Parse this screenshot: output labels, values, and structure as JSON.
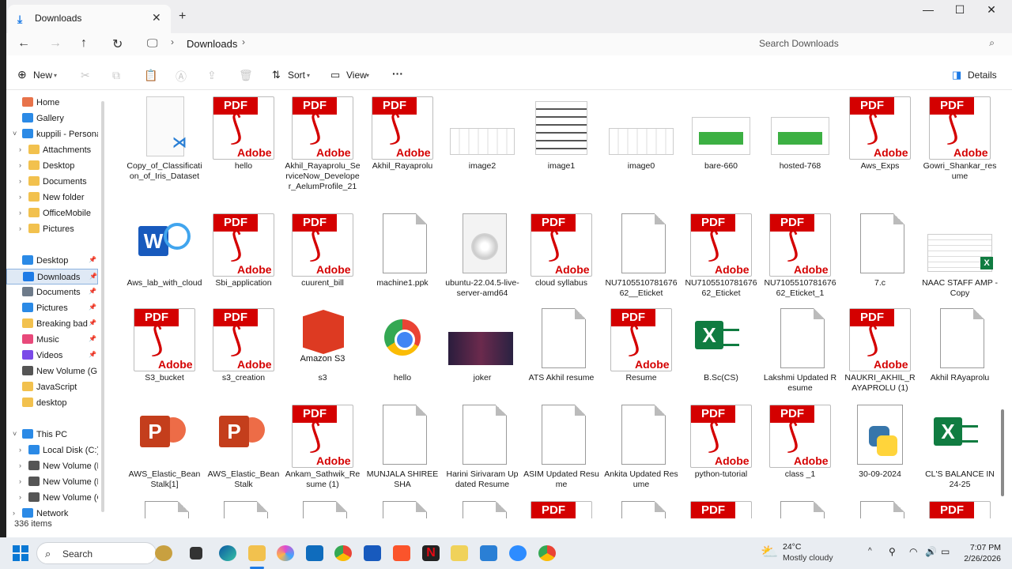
{
  "window": {
    "tab_title": "Downloads",
    "new_tab": "+",
    "controls": {
      "minimize": "—",
      "maximize": "☐",
      "close": "✕"
    }
  },
  "nav": {
    "breadcrumb": "Downloads",
    "search_placeholder": "Search Downloads"
  },
  "toolbar": {
    "new_label": "New",
    "sort_label": "Sort",
    "view_label": "View",
    "more_label": "···",
    "details_label": "Details"
  },
  "sidebar": {
    "items": [
      {
        "label": "Home",
        "color": "#e8734a"
      },
      {
        "label": "Gallery",
        "color": "#2b8ae6"
      },
      {
        "label": "kuppili - Personal",
        "color": "#2b8ae6"
      },
      {
        "label": "Attachments",
        "color": "#f2c14e"
      },
      {
        "label": "Desktop",
        "color": "#f2c14e"
      },
      {
        "label": "Documents",
        "color": "#f2c14e"
      },
      {
        "label": "New folder",
        "color": "#f2c14e"
      },
      {
        "label": "OfficeMobile",
        "color": "#f2c14e"
      },
      {
        "label": "Pictures",
        "color": "#f2c14e"
      },
      {
        "label": "Desktop",
        "color": "#2b8ae6"
      },
      {
        "label": "Downloads",
        "color": "#1e7be6"
      },
      {
        "label": "Documents",
        "color": "#6e7b8a"
      },
      {
        "label": "Pictures",
        "color": "#2b8ae6"
      },
      {
        "label": "Breaking bad",
        "color": "#f2c14e"
      },
      {
        "label": "Music",
        "color": "#e8497a"
      },
      {
        "label": "Videos",
        "color": "#7b4ae8"
      },
      {
        "label": "New Volume (G:)",
        "color": "#555555"
      },
      {
        "label": "JavaScript",
        "color": "#f2c14e"
      },
      {
        "label": "desktop",
        "color": "#f2c14e"
      },
      {
        "label": "This PC",
        "color": "#2b8ae6"
      },
      {
        "label": "Local Disk (C:)",
        "color": "#2b8ae6"
      },
      {
        "label": "New Volume (E:)",
        "color": "#555555"
      },
      {
        "label": "New Volume (F:)",
        "color": "#555555"
      },
      {
        "label": "New Volume (G:)",
        "color": "#555555"
      },
      {
        "label": "Network",
        "color": "#2b8ae6"
      }
    ],
    "status": "336 items"
  },
  "files": {
    "row1": [
      {
        "name": "Copy_of_Classification_of_Iris_Dataset",
        "icon": "vscode-file-icon"
      },
      {
        "name": "hello",
        "icon": "pdf-icon"
      },
      {
        "name": "Akhil_Rayaprolu_ServiceNow_Developer_AelumProfile_21",
        "icon": "pdf-icon"
      },
      {
        "name": "Akhil_Rayaprolu",
        "icon": "pdf-icon"
      },
      {
        "name": "image2",
        "icon": "image-thumbnail"
      },
      {
        "name": "image1",
        "icon": "image-thumbnail"
      },
      {
        "name": "image0",
        "icon": "image-thumbnail"
      },
      {
        "name": "bare-660",
        "icon": "image-thumbnail"
      },
      {
        "name": "hosted-768",
        "icon": "image-thumbnail"
      },
      {
        "name": "Aws_Exps",
        "icon": "pdf-icon"
      },
      {
        "name": "Gowri_Shankar_resume",
        "icon": "pdf-icon"
      }
    ],
    "row2": [
      {
        "name": "Aws_lab_with_cloud",
        "icon": "word-icon"
      },
      {
        "name": "Sbi_application",
        "icon": "pdf-icon"
      },
      {
        "name": "cuurent_bill",
        "icon": "pdf-icon"
      },
      {
        "name": "machine1.ppk",
        "icon": "blank-file-icon"
      },
      {
        "name": "ubuntu-22.04.5-live-server-amd64",
        "icon": "disc-image-icon"
      },
      {
        "name": "cloud syllabus",
        "icon": "pdf-icon"
      },
      {
        "name": "NU710551078167662__Eticket",
        "icon": "blank-file-icon"
      },
      {
        "name": "NU710551078167662_Eticket",
        "icon": "pdf-icon"
      },
      {
        "name": "NU710551078167662_Eticket_1",
        "icon": "pdf-icon"
      },
      {
        "name": "7.c",
        "icon": "blank-file-icon"
      },
      {
        "name": "NAAC STAFF AMP - Copy",
        "icon": "excel-thumbnail"
      }
    ],
    "row3": [
      {
        "name": "S3_bucket",
        "icon": "pdf-icon"
      },
      {
        "name": "s3_creation",
        "icon": "pdf-icon"
      },
      {
        "name": "s3",
        "icon": "amazon-s3-icon",
        "badge": "Amazon S3"
      },
      {
        "name": "hello",
        "icon": "chrome-icon"
      },
      {
        "name": "joker",
        "icon": "image-thumbnail"
      },
      {
        "name": "ATS Akhil resume",
        "icon": "blank-file-icon"
      },
      {
        "name": "Resume",
        "icon": "pdf-icon"
      },
      {
        "name": "B.Sc(CS)",
        "icon": "excel-icon"
      },
      {
        "name": "Lakshmi Updated Resume",
        "icon": "blank-file-icon"
      },
      {
        "name": "NAUKRI_AKHIL_RAYAPROLU (1)",
        "icon": "pdf-icon"
      },
      {
        "name": "Akhil RAyaprolu",
        "icon": "blank-file-icon"
      }
    ],
    "row4": [
      {
        "name": "AWS_Elastic_BeanStalk[1]",
        "icon": "powerpoint-icon"
      },
      {
        "name": "AWS_Elastic_BeanStalk",
        "icon": "powerpoint-icon"
      },
      {
        "name": "Ankam_Sathwik_Resume (1)",
        "icon": "pdf-icon"
      },
      {
        "name": "MUNJALA SHIREESHA",
        "icon": "blank-file-icon"
      },
      {
        "name": "Harini Sirivaram Updated Resume",
        "icon": "blank-file-icon"
      },
      {
        "name": "ASIM Updated Resume",
        "icon": "blank-file-icon"
      },
      {
        "name": "Ankita Updated Resume",
        "icon": "blank-file-icon"
      },
      {
        "name": "python-tutorial",
        "icon": "pdf-icon"
      },
      {
        "name": "class _1",
        "icon": "pdf-icon"
      },
      {
        "name": "30-09-2024",
        "icon": "python-file-icon"
      },
      {
        "name": "CL'S BALANCE IN 24-25",
        "icon": "excel-icon"
      }
    ],
    "pdf_tag": "PDF",
    "pdf_brand": "Adobe"
  },
  "taskbar": {
    "search_label": "Search",
    "weather_temp": "24°C",
    "weather_desc": "Mostly cloudy",
    "time": "7:07 PM",
    "date": "2/26/2026"
  }
}
